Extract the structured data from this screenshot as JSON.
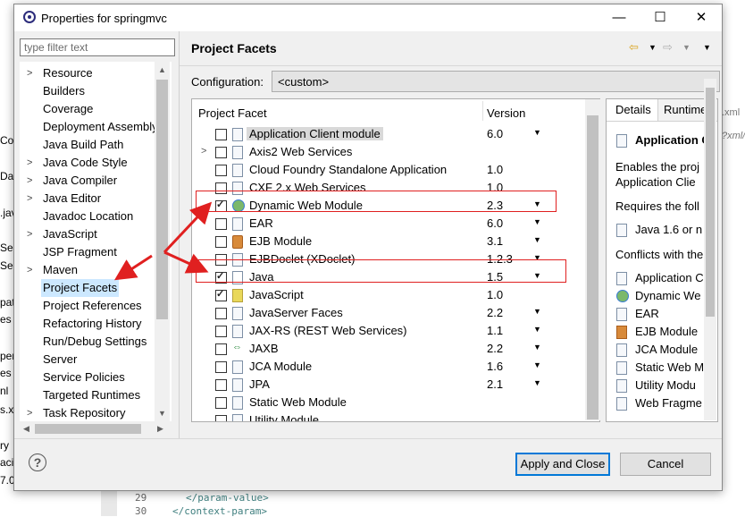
{
  "window": {
    "title": "Properties for springmvc",
    "minimize": "—",
    "maximize": "☐",
    "close": "✕"
  },
  "filter": {
    "placeholder": "type filter text"
  },
  "tree": {
    "items": [
      {
        "label": "Resource",
        "expandable": true
      },
      {
        "label": "Builders",
        "expandable": false
      },
      {
        "label": "Coverage",
        "expandable": false
      },
      {
        "label": "Deployment Assembly",
        "expandable": false
      },
      {
        "label": "Java Build Path",
        "expandable": false
      },
      {
        "label": "Java Code Style",
        "expandable": true
      },
      {
        "label": "Java Compiler",
        "expandable": true
      },
      {
        "label": "Java Editor",
        "expandable": true
      },
      {
        "label": "Javadoc Location",
        "expandable": false
      },
      {
        "label": "JavaScript",
        "expandable": true
      },
      {
        "label": "JSP Fragment",
        "expandable": false
      },
      {
        "label": "Maven",
        "expandable": true
      },
      {
        "label": "Project Facets",
        "expandable": false,
        "selected": true
      },
      {
        "label": "Project References",
        "expandable": false
      },
      {
        "label": "Refactoring History",
        "expandable": false
      },
      {
        "label": "Run/Debug Settings",
        "expandable": false
      },
      {
        "label": "Server",
        "expandable": false
      },
      {
        "label": "Service Policies",
        "expandable": false
      },
      {
        "label": "Targeted Runtimes",
        "expandable": false
      },
      {
        "label": "Task Repository",
        "expandable": true
      }
    ]
  },
  "page": {
    "heading": "Project Facets",
    "configuration_label": "Configuration:",
    "configuration_value": "<custom>"
  },
  "facets": {
    "col_facet": "Project Facet",
    "col_version": "Version",
    "rows": [
      {
        "name": "Application Client module",
        "version": "6.0",
        "checked": false,
        "dropdown": true,
        "highlight": true,
        "icon": "doc"
      },
      {
        "name": "Axis2 Web Services",
        "version": "",
        "checked": false,
        "dropdown": false,
        "expandable": true,
        "icon": "doc"
      },
      {
        "name": "Cloud Foundry Standalone Application",
        "version": "1.0",
        "checked": false,
        "dropdown": false,
        "icon": "doc"
      },
      {
        "name": "CXF 2.x Web Services",
        "version": "1.0",
        "checked": false,
        "dropdown": false,
        "icon": "doc"
      },
      {
        "name": "Dynamic Web Module",
        "version": "2.3",
        "checked": true,
        "dropdown": true,
        "icon": "globe"
      },
      {
        "name": "EAR",
        "version": "6.0",
        "checked": false,
        "dropdown": true,
        "icon": "doc"
      },
      {
        "name": "EJB Module",
        "version": "3.1",
        "checked": false,
        "dropdown": true,
        "icon": "ejb"
      },
      {
        "name": "EJBDoclet (XDoclet)",
        "version": "1.2.3",
        "checked": false,
        "dropdown": true,
        "icon": "doc"
      },
      {
        "name": "Java",
        "version": "1.5",
        "checked": true,
        "dropdown": true,
        "icon": "jar"
      },
      {
        "name": "JavaScript",
        "version": "1.0",
        "checked": true,
        "dropdown": false,
        "icon": "js"
      },
      {
        "name": "JavaServer Faces",
        "version": "2.2",
        "checked": false,
        "dropdown": true,
        "icon": "doc"
      },
      {
        "name": "JAX-RS (REST Web Services)",
        "version": "1.1",
        "checked": false,
        "dropdown": true,
        "icon": "doc"
      },
      {
        "name": "JAXB",
        "version": "2.2",
        "checked": false,
        "dropdown": true,
        "icon": "arrows"
      },
      {
        "name": "JCA Module",
        "version": "1.6",
        "checked": false,
        "dropdown": true,
        "icon": "doc"
      },
      {
        "name": "JPA",
        "version": "2.1",
        "checked": false,
        "dropdown": true,
        "icon": "doc"
      },
      {
        "name": "Static Web Module",
        "version": "",
        "checked": false,
        "dropdown": false,
        "icon": "doc"
      },
      {
        "name": "Utility Module",
        "version": "",
        "checked": false,
        "dropdown": false,
        "icon": "doc"
      }
    ]
  },
  "details": {
    "tab_details": "Details",
    "tab_runtimes": "Runtimes",
    "heading": "Application C",
    "desc1": "Enables the proj",
    "desc2": "Application Clie",
    "requires": "Requires the foll",
    "req_item": "Java 1.6 or n",
    "conflicts": "Conflicts with the",
    "conflict_items": [
      "Application C",
      "Dynamic We",
      "EAR",
      "EJB Module",
      "JCA Module",
      "Static Web M",
      "Utility Modu",
      "Web Fragme"
    ]
  },
  "buttons": {
    "apply_close": "Apply and Close",
    "cancel": "Cancel",
    "help": "?"
  },
  "background": {
    "left_fragments": [
      "Co",
      "Da",
      ".jav",
      "Se",
      "Se",
      "pat",
      "es",
      "per",
      "es",
      "nl",
      "s.x",
      "ry",
      "acie",
      "7.0"
    ],
    "right_tabs": [
      ".xml",
      "?xml/"
    ],
    "editor_lines": [
      {
        "num": "29",
        "code": "</param-value>"
      },
      {
        "num": "30",
        "code": "</context-param>"
      }
    ]
  }
}
